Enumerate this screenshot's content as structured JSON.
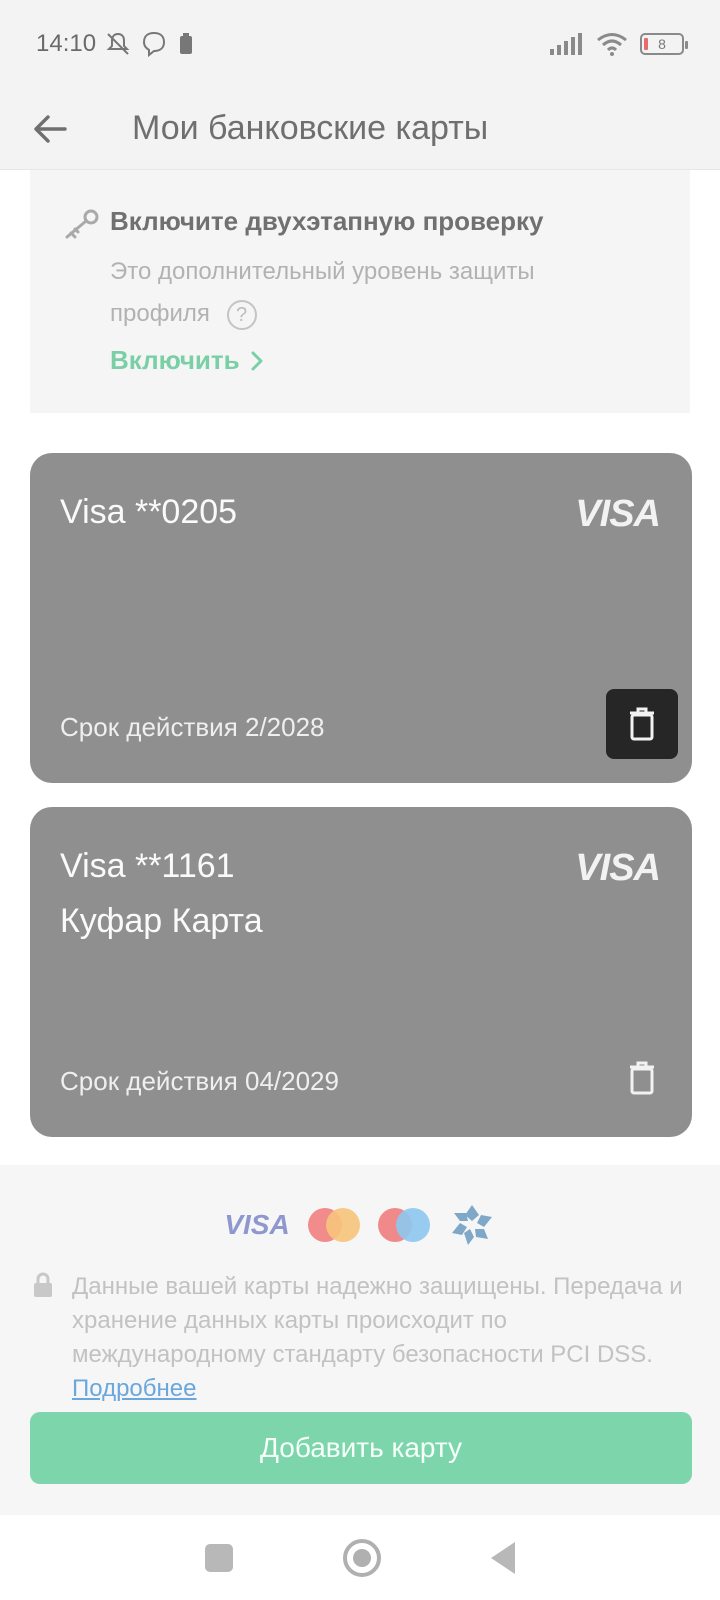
{
  "status_bar": {
    "time": "14:10",
    "battery_level": "8"
  },
  "header": {
    "title": "Мои банковские карты"
  },
  "banner": {
    "title": "Включите двухэтапную проверку",
    "description": "Это дополнительный уровень защиты профиля",
    "help_symbol": "?",
    "action_label": "Включить"
  },
  "cards": [
    {
      "number": "Visa **0205",
      "name": "",
      "brand": "VISA",
      "expiry": "Срок действия 2/2028"
    },
    {
      "number": "Visa **1161",
      "name": "Куфар Карта",
      "brand": "VISA",
      "expiry": "Срок действия 04/2029"
    }
  ],
  "footer": {
    "payment_logos": [
      "VISA",
      "mastercard",
      "maestro",
      "belkart"
    ],
    "visa_logo_text": "VISA",
    "security_text": "Данные вашей карты надежно защищены. Передача и хранение данных карты происходит по международному стандарту безопасности PCI DSS.",
    "more_link": "Подробнее",
    "add_card_label": "Добавить карту"
  },
  "icons": {
    "back": "arrow-left-icon",
    "key": "key-icon",
    "delete": "trash-icon",
    "lock": "lock-icon"
  },
  "colors": {
    "accent_green": "#7dd6ab",
    "card_gray": "#8f8f8f",
    "link_blue": "#6aa7dc"
  }
}
